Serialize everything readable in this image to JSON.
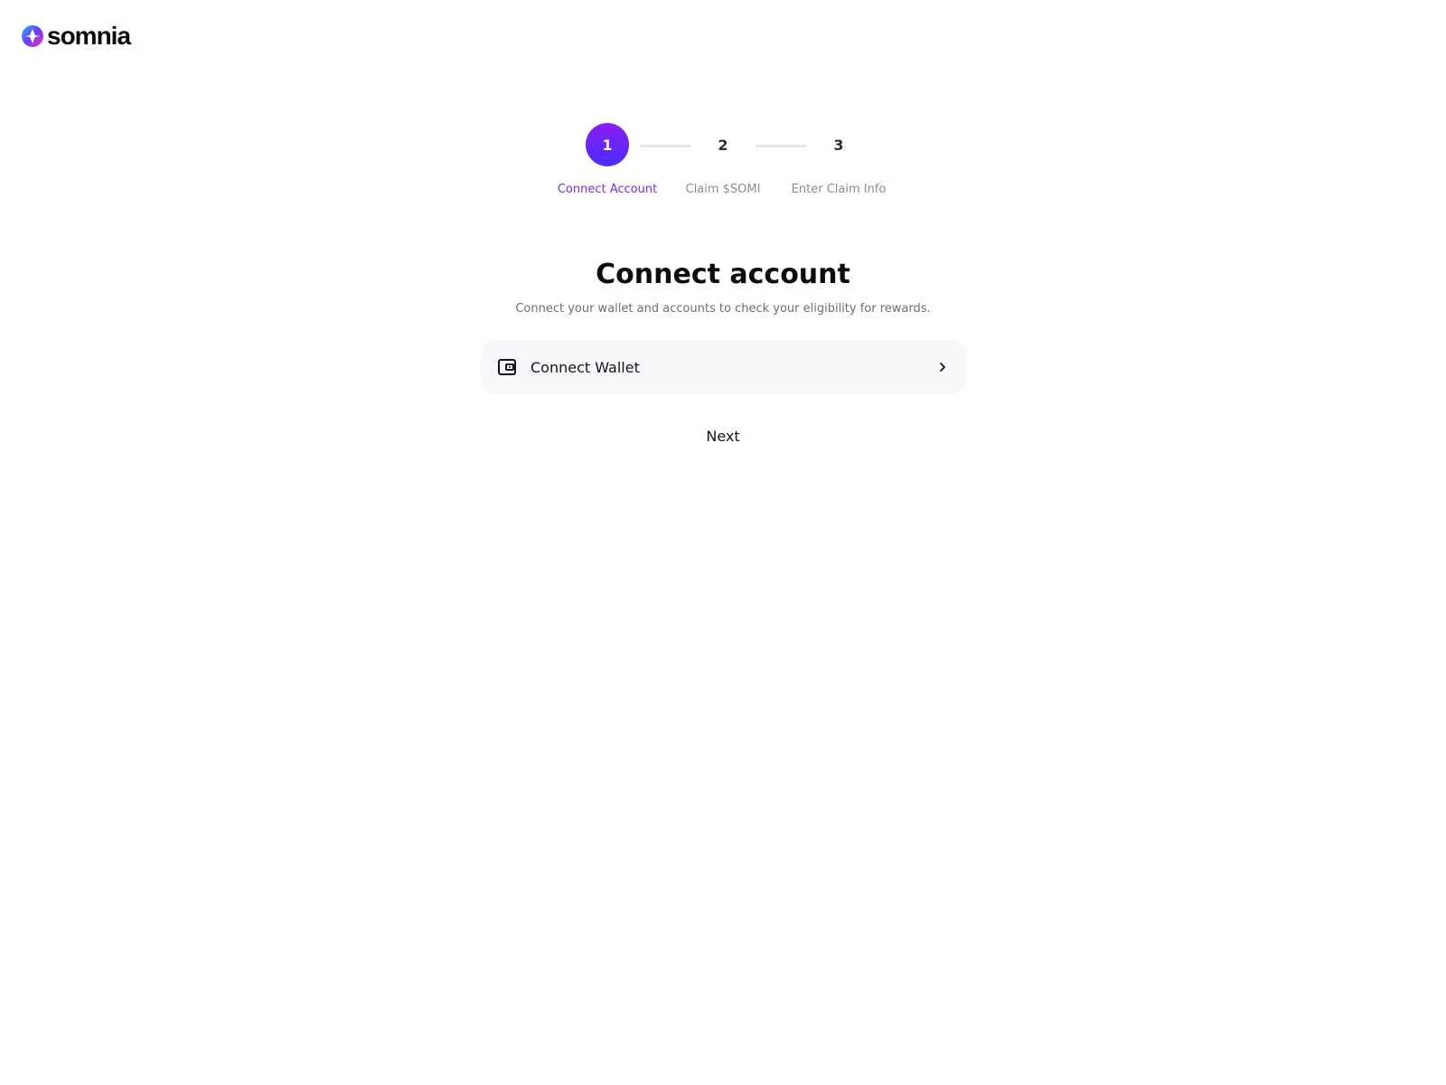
{
  "brand": {
    "name": "somnia",
    "logo_icon": "somnia-logo-icon"
  },
  "stepper": {
    "active_step": 1,
    "steps": [
      {
        "number": "1",
        "label": "Connect Account",
        "state": "active"
      },
      {
        "number": "2",
        "label": "Claim $SOMI",
        "state": "pending"
      },
      {
        "number": "3",
        "label": "Enter Claim Info",
        "state": "pending"
      }
    ]
  },
  "main": {
    "title": "Connect account",
    "subtitle": "Connect your wallet and accounts to check your eligibility for rewards.",
    "connect_wallet": {
      "label": "Connect Wallet",
      "icon": "wallet-icon",
      "trailing_icon": "chevron-right-icon"
    },
    "next_label": "Next"
  },
  "colors": {
    "accent": "#7a2bf0",
    "accent_gradient_start": "#8b1ef2",
    "accent_gradient_end": "#4a2cff",
    "row_background": "#f7f8fa"
  }
}
